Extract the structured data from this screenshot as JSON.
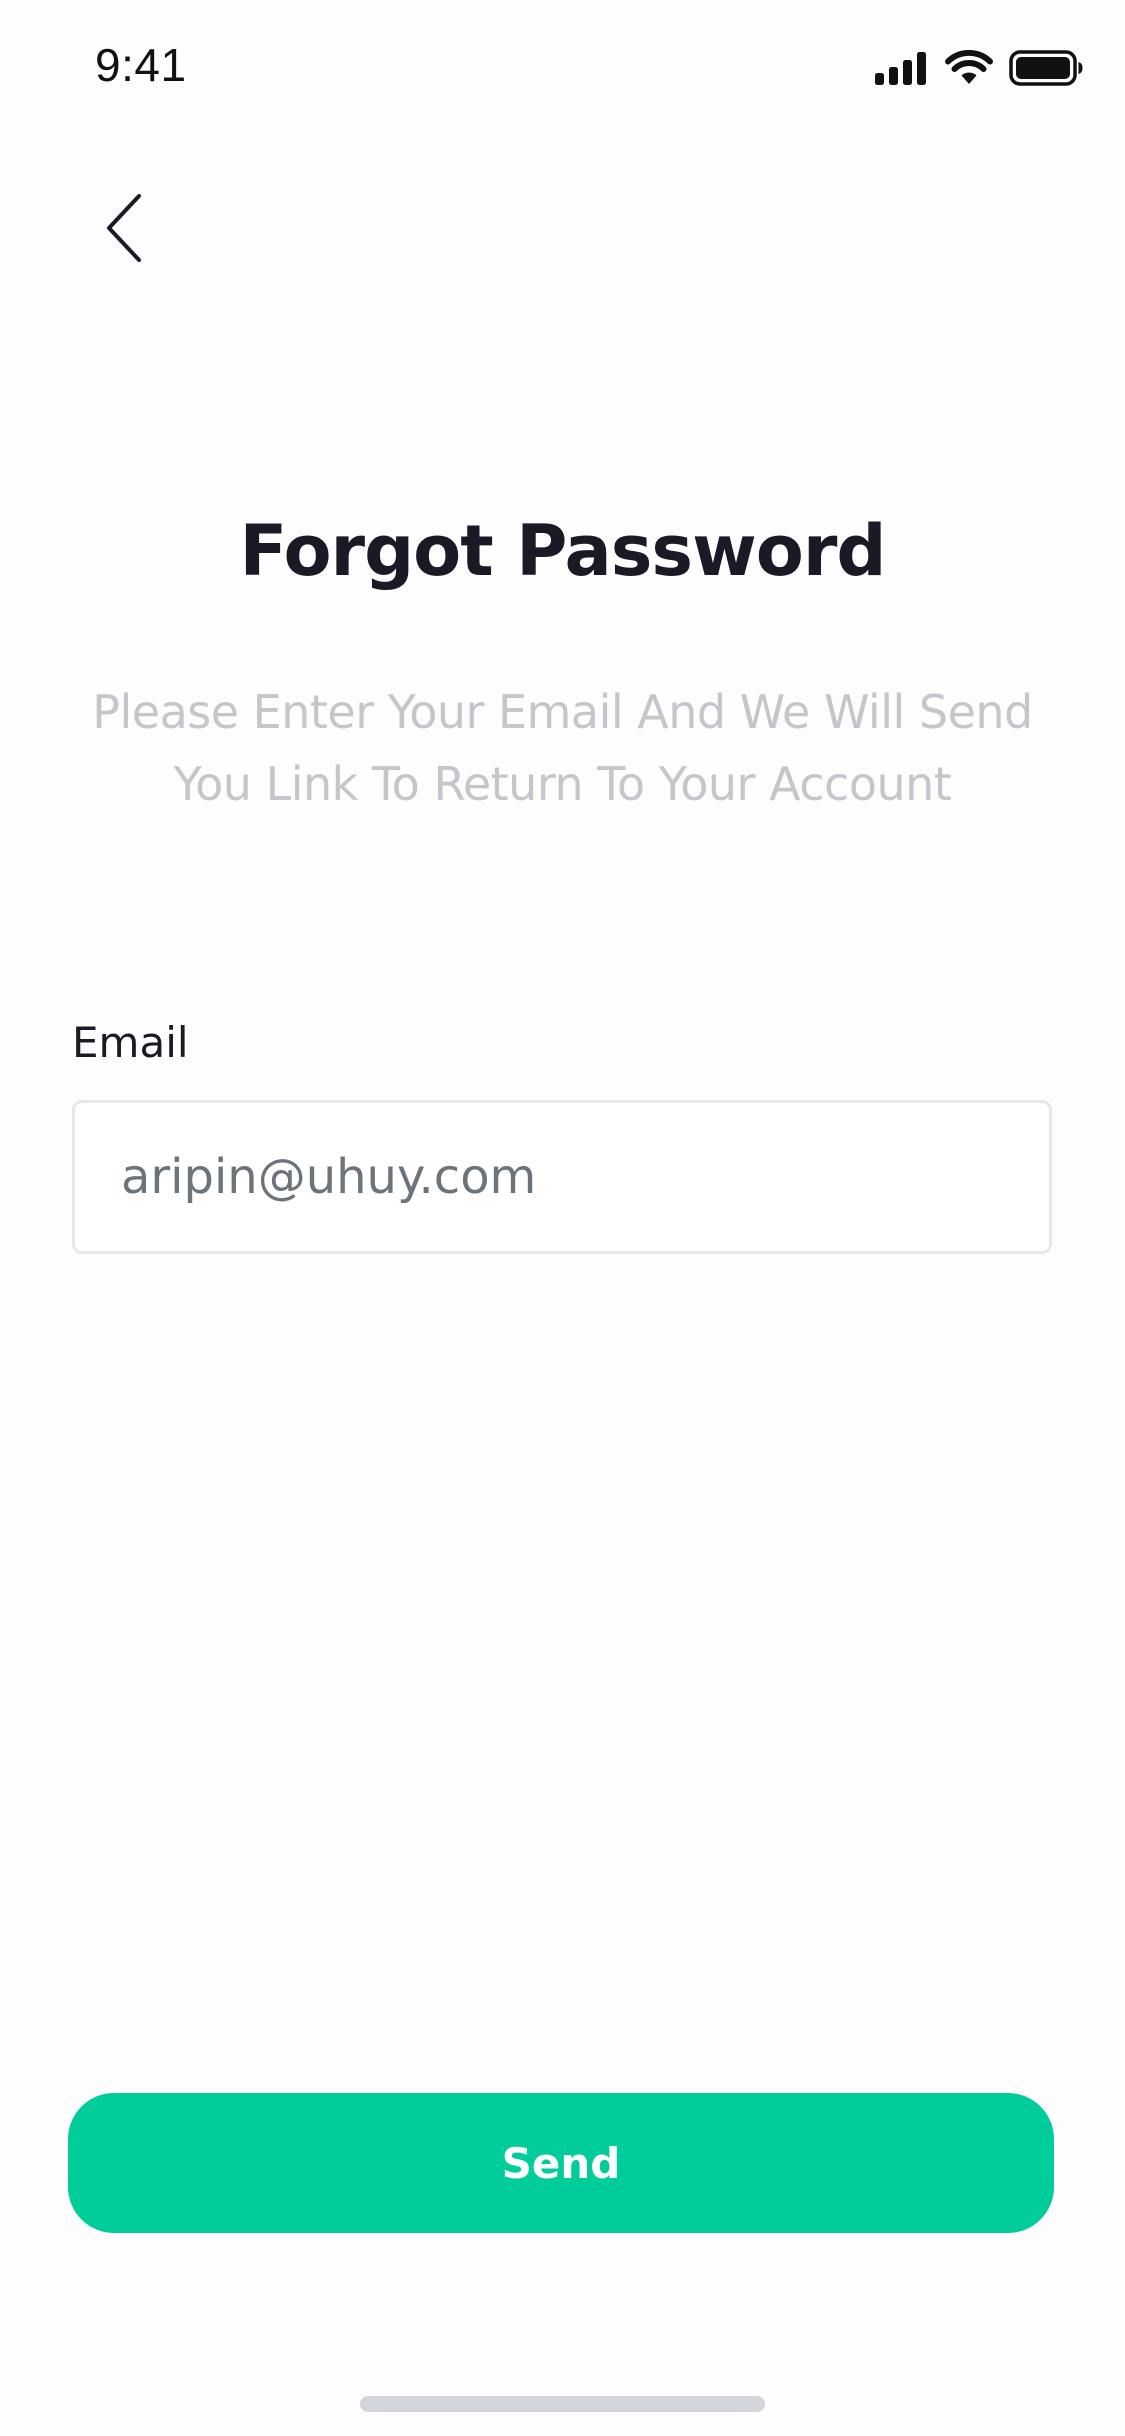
{
  "status_bar": {
    "time": "9:41",
    "icons": [
      "cellular-signal-icon",
      "wifi-icon",
      "battery-icon"
    ]
  },
  "nav": {
    "back_icon": "chevron-left-icon"
  },
  "header": {
    "title": "Forgot Password",
    "subtitle": "Please Enter Your Email And We Will Send You Link To Return To Your Account"
  },
  "form": {
    "email_label": "Email",
    "email_value": "aripin@uhuy.com"
  },
  "actions": {
    "send_label": "Send"
  },
  "colors": {
    "accent": "#00CD99",
    "title": "#1A1A26",
    "subtitle": "#C4C6CC",
    "input_text": "#6B737B",
    "input_border": "#E6E8EB",
    "home_indicator": "#D2D6DA"
  }
}
